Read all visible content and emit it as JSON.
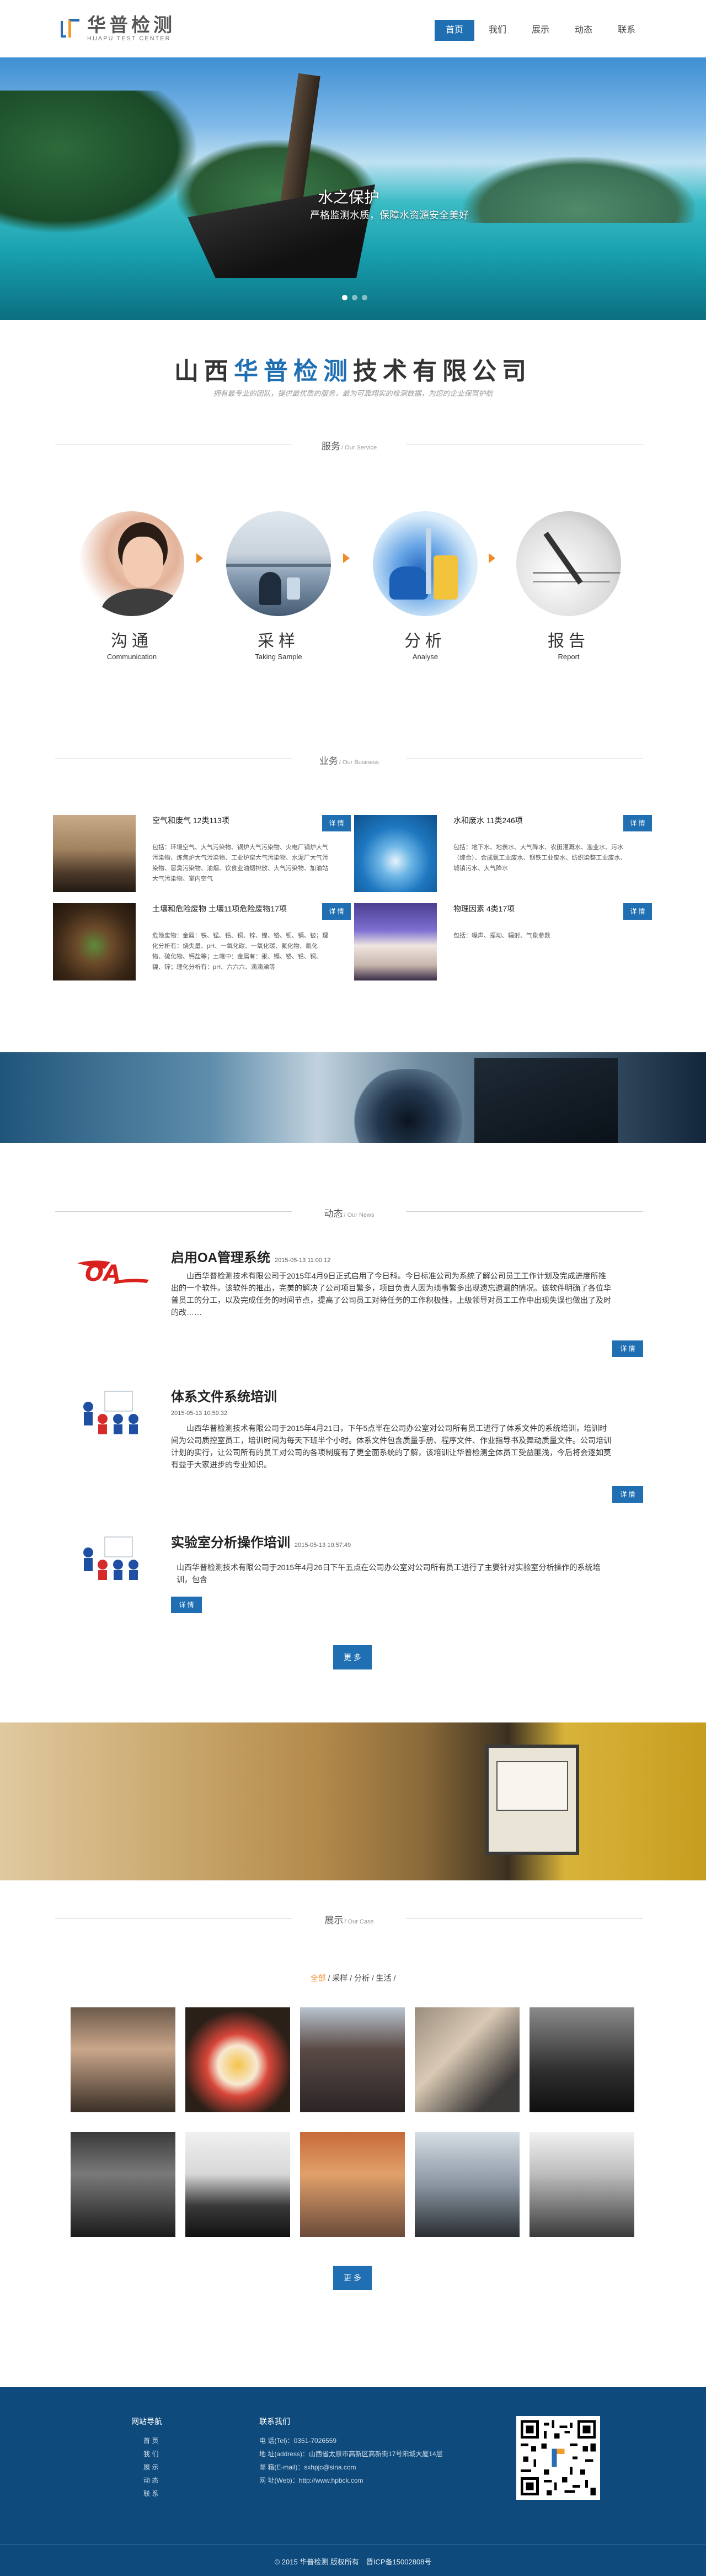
{
  "header": {
    "logo_cn": "华普检测",
    "logo_en": "HUAPU TEST CENTER",
    "nav": [
      "首页",
      "我们",
      "展示",
      "动态",
      "联系"
    ]
  },
  "banner": {
    "title": "水之保护",
    "subtitle": "严格监测水质，保障水资源安全美好"
  },
  "company": {
    "name_a": "山西",
    "name_b": "华普检测",
    "name_c": "技术有限公司",
    "slogan": "拥有最专业的团队，提供最优质的服务，最为可靠翔实的检测数据，为您的企业保驾护航"
  },
  "services": {
    "heading": "服务",
    "heading_en": "/ Our Service",
    "items": [
      {
        "name": "沟通",
        "en": "Communication"
      },
      {
        "name": "采样",
        "en": "Taking Sample"
      },
      {
        "name": "分析",
        "en": "Analyse"
      },
      {
        "name": "报告",
        "en": "Report"
      }
    ]
  },
  "business": {
    "heading": "业务",
    "heading_en": "/ Our Business",
    "detail_label": "详 情",
    "items": [
      {
        "title": "空气和废气 12类113项",
        "desc": "包括：环境空气、大气污染物、锅炉大气污染物、火电厂锅炉大气污染物、炼焦炉大气污染物、工业炉窑大气污染物、水泥厂大气污染物、恶臭污染物、油烟、饮食业油烟排放、大气污染物、加油站大气污染物、室内空气"
      },
      {
        "title": "水和废水 11类246项",
        "desc": "包括：地下水、地表水、大气降水、农田灌溉水、渔业水、污水（综合）、合成氨工业废水、钢铁工业废水、纺织染整工业废水、城镇污水、大气降水"
      },
      {
        "title": "土壤和危险废物 土壤11项危险废物17项",
        "desc": "危险废物：金属：铁、锰、铅、铜、锌、镍、铬、钡、镉、铍；理化分析有：烧失量、pH、一氧化碳、一氧化碳、氟化物、氰化物、硫化物、钙盐等；土壤中：金属有：汞、镉、铬、铅、铜、镍、锌；理化分析有：pH、六六六、滴滴涕等"
      },
      {
        "title": "物理因素 4类17项",
        "desc": "包括：噪声、振动、辐射、气象参数"
      }
    ]
  },
  "news": {
    "heading": "动态",
    "heading_en": "/ Our News",
    "detail_label": "详 情",
    "more_label": "更 多",
    "items": [
      {
        "title": "启用OA管理系统",
        "date": "2015-05-13 11:00:12",
        "body": "山西华普检测技术有限公司于2015年4月9日正式启用了今日科。今日标准公司为系统了解公司员工工作计划及完成进度所推出的一个软件。该软件的推出，完美的解决了公司项目繁多，项目负责人因为琐事繁多出现遗忘遗漏的情况。该软件明确了各位华普员工的分工，以及完成任务的时间节点，提高了公司员工对待任务的工作积极性，上级领导对员工工作中出现失误也做出了及时的改……"
      },
      {
        "title": "体系文件系统培训",
        "date": "2015-05-13 10:59:32",
        "body": "山西华普检测技术有限公司于2015年4月21日，下午5点半在公司办公室对公司所有员工进行了体系文件的系统培训，培训时间为公司质控室员工，培训时间为每天下班半个小时。体系文件包含质量手册、程序文件、作业指导书及舞动质量文件。公司培训计划的实行，让公司所有的员工对公司的各项制度有了更全面系统的了解，该培训让华普检测全体员工受益匪浅，今后将会逐如莫有益于大家进步的专业知识。"
      },
      {
        "title": "实验室分析操作培训",
        "date": "2015-05-13 10:57:49",
        "body": "山西华普检测技术有限公司于2015年4月26日下午五点在公司办公室对公司所有员工进行了主要针对实验室分析操作的系统培训，包含"
      }
    ]
  },
  "cases": {
    "heading": "展示",
    "heading_en": "/ Our Case",
    "filters": [
      "全部",
      "采样",
      "分析",
      "生活"
    ],
    "more_label": "更 多"
  },
  "footer": {
    "nav_title": "网站导航",
    "nav_items": [
      "首 页",
      "我 们",
      "展 示",
      "动 态",
      "联 系"
    ],
    "contact_title": "联系我们",
    "contact_items": [
      "电 话(Tel)：0351-7026559",
      "地 址(address)：山西省太原市高新区高新街17号阳城大厦14层",
      "邮 箱(E-mail)：sxhpjc@sina.com",
      "网 址(Web)：http://www.hpbck.com"
    ],
    "copyright": "© 2015 华普检测 版权所有　晋ICP备15002808号"
  },
  "colors": {
    "accent": "#1f6fb2",
    "orange": "#f08a24",
    "footer": "#0e4a7c"
  }
}
